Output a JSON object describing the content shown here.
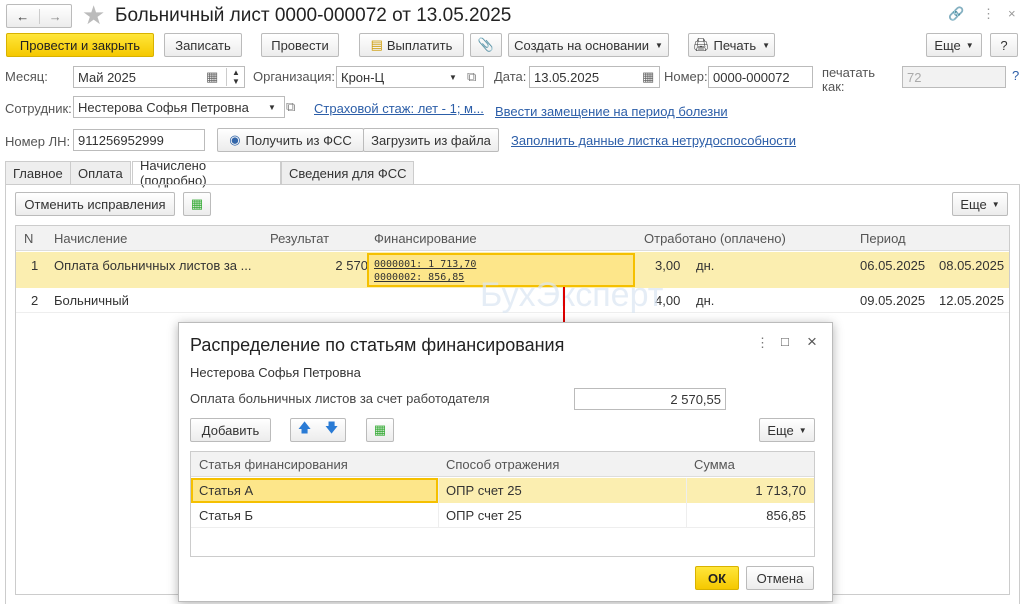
{
  "window": {
    "title": "Больничный лист 0000-000072 от 13.05.2025"
  },
  "toolbar": {
    "post_close": "Провести и закрыть",
    "save": "Записать",
    "post": "Провести",
    "pay": "Выплатить",
    "create_based": "Создать на основании",
    "print": "Печать",
    "more": "Еще",
    "help": "?"
  },
  "form": {
    "month_label": "Месяц:",
    "month": "Май 2025",
    "org_label": "Организация:",
    "org": "Крон-Ц",
    "date_label": "Дата:",
    "date": "13.05.2025",
    "number_label": "Номер:",
    "number": "0000-000072",
    "print_as_label": "печатать как:",
    "print_as": "72",
    "help": "?",
    "employee_label": "Сотрудник:",
    "employee": "Нестерова Софья Петровна",
    "insurance_link": "Страховой стаж: лет - 1; м...",
    "replace_link": "Ввести замещение на период болезни",
    "ln_label": "Номер ЛН:",
    "ln": "911256952999",
    "get_fss": "Получить из ФСС",
    "load_file": "Загрузить из файла",
    "fill_link": "Заполнить данные листка нетрудоспособности"
  },
  "tabs": [
    "Главное",
    "Оплата",
    "Начислено (подробно)",
    "Сведения для ФСС"
  ],
  "table_toolbar": {
    "cancel_fix": "Отменить исправления",
    "more": "Еще"
  },
  "table": {
    "headers": [
      "N",
      "Начисление",
      "Результат",
      "Финансирование",
      "Отработано (оплачено)",
      "Период"
    ],
    "rows": [
      {
        "n": "1",
        "name": "Оплата больничных листов за ...",
        "result": "2 570,55",
        "fin": [
          "0000001: 1 713,70",
          "0000002: 856,85"
        ],
        "worked": "3,00",
        "unit": "дн.",
        "from": "06.05.2025",
        "to": "08.05.2025"
      },
      {
        "n": "2",
        "name": "Больничный",
        "result": "",
        "fin": [],
        "worked": "4,00",
        "unit": "дн.",
        "from": "09.05.2025",
        "to": "12.05.2025"
      }
    ]
  },
  "watermark": "БухЭксперт",
  "dialog": {
    "title": "Распределение по статьям финансирования",
    "employee": "Нестерова Софья Петровна",
    "sum_label": "Оплата больничных листов за счет работодателя",
    "sum": "2 570,55",
    "add": "Добавить",
    "more": "Еще",
    "headers": [
      "Статья финансирования",
      "Способ отражения",
      "Сумма"
    ],
    "rows": [
      {
        "item": "Статья А",
        "method": "ОПР счет 25",
        "sum": "1 713,70"
      },
      {
        "item": "Статья Б",
        "method": "ОПР счет 25",
        "sum": "856,85"
      }
    ],
    "ok": "ОК",
    "cancel": "Отмена"
  },
  "colors": {
    "accent": "#f5c800",
    "selected_row": "#fbeeb0",
    "link": "#2c5ea8"
  }
}
